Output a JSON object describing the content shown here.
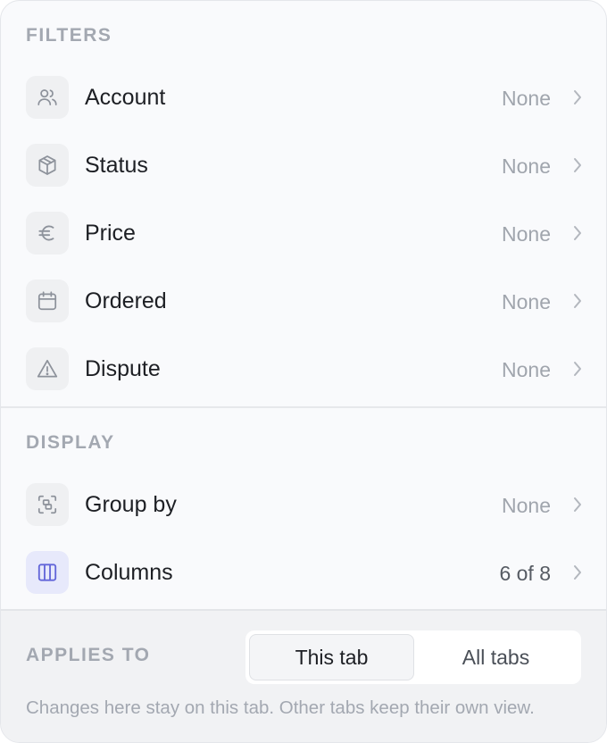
{
  "filters": {
    "title": "FILTERS",
    "items": [
      {
        "label": "Account",
        "value": "None",
        "icon": "users-icon"
      },
      {
        "label": "Status",
        "value": "None",
        "icon": "box-icon"
      },
      {
        "label": "Price",
        "value": "None",
        "icon": "euro-icon"
      },
      {
        "label": "Ordered",
        "value": "None",
        "icon": "calendar-icon"
      },
      {
        "label": "Dispute",
        "value": "None",
        "icon": "warning-icon"
      }
    ]
  },
  "display": {
    "title": "DISPLAY",
    "items": [
      {
        "label": "Group by",
        "value": "None",
        "icon": "group-icon"
      },
      {
        "label": "Columns",
        "value": "6 of 8",
        "icon": "columns-icon"
      }
    ]
  },
  "footer": {
    "applies_label": "APPLIES TO",
    "options": [
      "This tab",
      "All tabs"
    ],
    "selected": "This tab",
    "hint": "Changes here stay on this tab. Other tabs keep their own view."
  },
  "colors": {
    "accent": "#6366d9",
    "icon_gray": "#8d929b",
    "label": "#1d1f24",
    "muted": "#a0a5ad"
  }
}
